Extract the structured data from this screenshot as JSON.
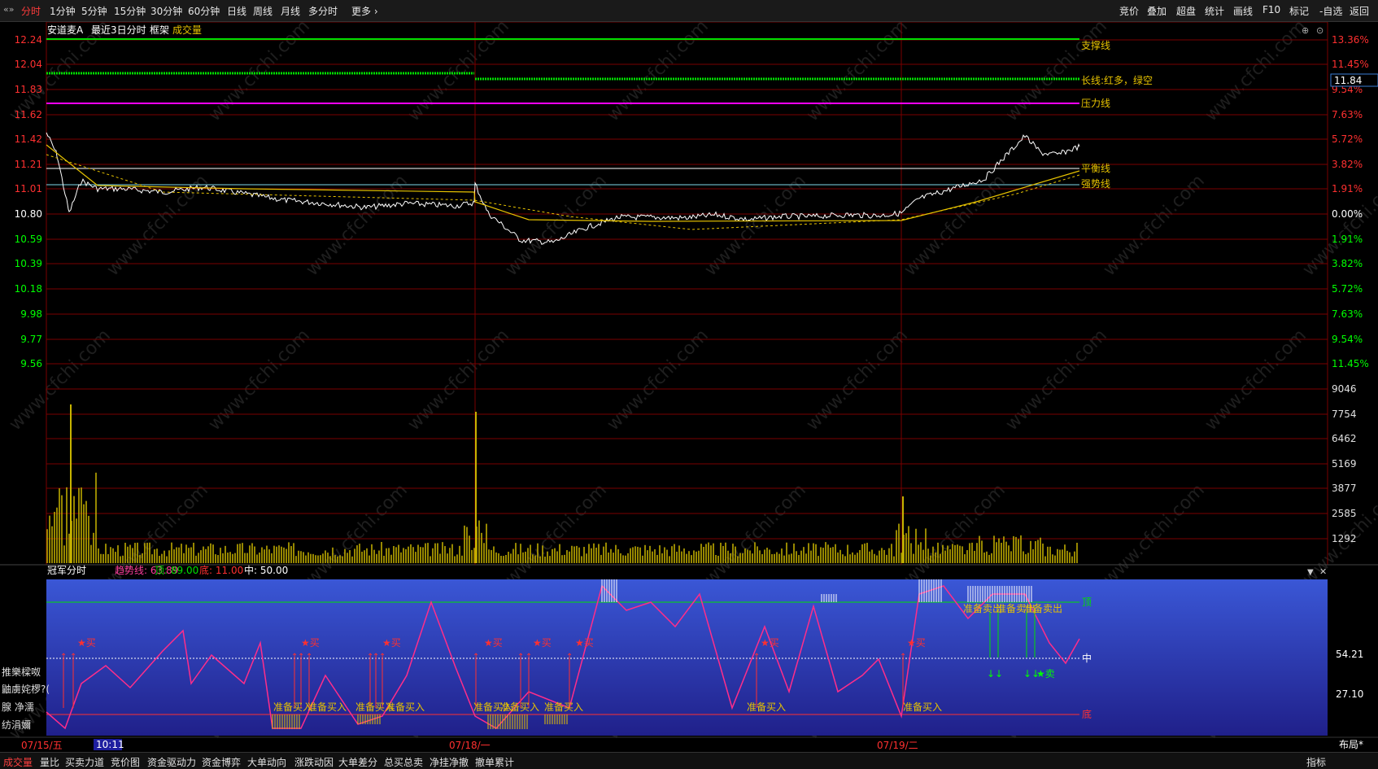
{
  "topbar": {
    "periods": [
      "分时",
      "1分钟",
      "5分钟",
      "15分钟",
      "30分钟",
      "60分钟",
      "日线",
      "周线",
      "月线",
      "多分时",
      "更多 ›"
    ],
    "right_buttons": [
      "竞价",
      "叠加",
      "超盘",
      "统计",
      "画线",
      "F10",
      "标记",
      "-自选",
      "返回"
    ]
  },
  "price_panel": {
    "stock_name": "安道麦A",
    "mode_label": "最近3日分时",
    "frame_label": "框架",
    "volume_label": "成交量",
    "price_ticks": [
      "12.24",
      "12.04",
      "11.83",
      "11.62",
      "11.42",
      "11.21",
      "11.01",
      "10.80",
      "10.59",
      "10.39",
      "10.18",
      "9.98",
      "9.77",
      "9.56"
    ],
    "pct_ticks": [
      "13.36%",
      "11.45%",
      "9.54%",
      "7.63%",
      "5.72%",
      "3.82%",
      "1.91%",
      "0.00%",
      "1.91%",
      "3.82%",
      "5.72%",
      "7.63%",
      "9.54%",
      "11.45%"
    ],
    "current_price": "11.84",
    "lines": {
      "support": "支撑线",
      "long": "长线:红多，绿空",
      "pressure": "压力线",
      "balance": "平衡线",
      "strong": "强势线"
    }
  },
  "volume_panel": {
    "ticks": [
      "9046",
      "7754",
      "6462",
      "5169",
      "3877",
      "2585",
      "1292"
    ]
  },
  "indicator_panel": {
    "name": "冠军分时",
    "trend_label": "趋势线: 63.89",
    "top_label": "顶: 89.00",
    "bottom_label": "底: 11.00",
    "mid_label": "中: 50.00",
    "right_ticks": [
      "54.21",
      "27.10"
    ],
    "level_top": "顶",
    "level_mid": "中",
    "level_bottom": "底",
    "buy_text": "准备买入",
    "sell_text": "准备卖出",
    "buy_mark": "★买",
    "sell_mark": "★卖",
    "left_cut": [
      "推樂樑呶",
      "鼬虜姹椤?(",
      "腺  净濡",
      "纺涓嬭"
    ]
  },
  "dates": [
    "07/15/五",
    "07/18/一",
    "07/19/二"
  ],
  "time_box": "10:11",
  "layout_button": "布局*",
  "bottom_tabs": [
    "成交量",
    "量比",
    "买卖力道",
    "竞价图",
    "资金驱动力",
    "资金博弈",
    "大单动向",
    "涨跌动因",
    "大单差分",
    "总买总卖",
    "净挂净撤",
    "撤单累计"
  ],
  "right_bottom": "指标",
  "watermark": "www.cfchi.com",
  "colors": {
    "grid_red": "#7a0000",
    "up": "#ff3030",
    "down": "#00ff00",
    "price_line": "#ffffff",
    "avg_line": "#e6c200",
    "pressure_line": "#ff00ff",
    "indicator_bg": "#2424a8",
    "volume": "#c8b400"
  }
}
